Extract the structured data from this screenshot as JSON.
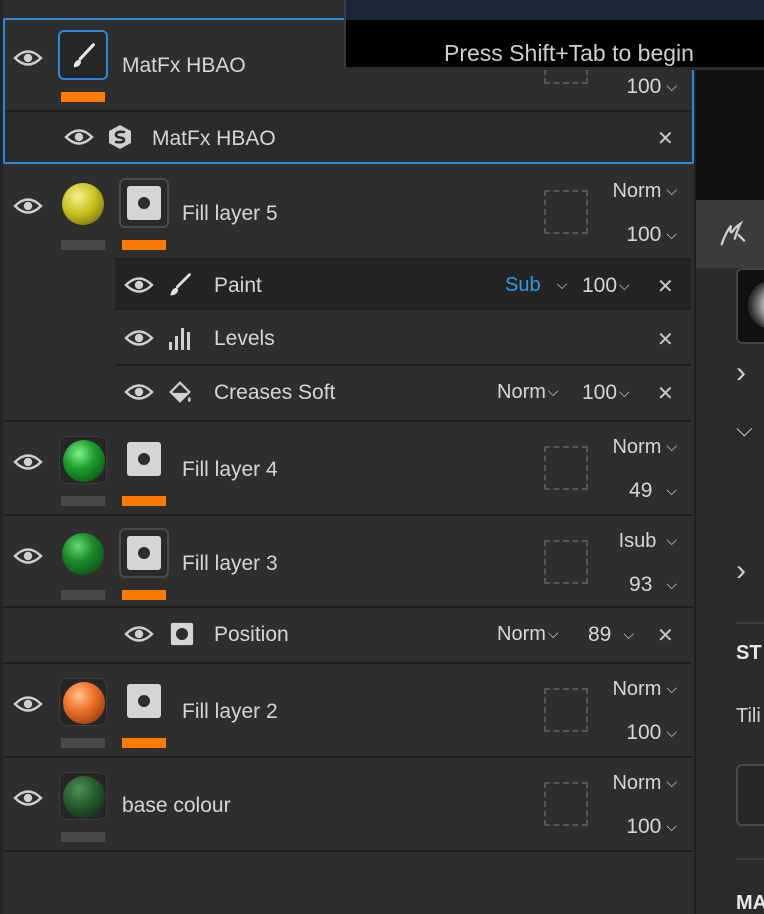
{
  "tooltip": {
    "message": "Press Shift+Tab to begin"
  },
  "layers": [
    {
      "name": "MatFx HBAO",
      "type": "paint",
      "opacity": "100",
      "selected": true,
      "effects": [
        {
          "name": "MatFx HBAO",
          "icon": "substance-icon"
        }
      ]
    },
    {
      "name": "Fill layer 5",
      "ball_color": "#c9c21f",
      "blend": "Norm",
      "opacity": "100",
      "effects": [
        {
          "name": "Paint",
          "icon": "brush-icon",
          "blend": "Sub",
          "opacity": "100"
        },
        {
          "name": "Levels",
          "icon": "levels-icon"
        },
        {
          "name": "Creases Soft",
          "icon": "fill-bucket-icon",
          "blend": "Norm",
          "opacity": "100"
        }
      ]
    },
    {
      "name": "Fill layer 4",
      "ball_color": "#1e9e2e",
      "blend": "Norm",
      "opacity": "49"
    },
    {
      "name": "Fill layer 3",
      "ball_color": "#1d8a2a",
      "blend": "Isub",
      "opacity": "93",
      "effects": [
        {
          "name": "Position",
          "icon": "mask-icon",
          "blend": "Norm",
          "opacity": "89"
        }
      ]
    },
    {
      "name": "Fill layer 2",
      "ball_color": "#f0712a",
      "blend": "Norm",
      "opacity": "100"
    },
    {
      "name": "base colour",
      "ball_color": "#245a2c",
      "blend": "Norm",
      "opacity": "100"
    }
  ],
  "right_panel": {
    "section_heading": "ST",
    "tiling_label": "Tili",
    "bottom_heading": "MA"
  },
  "glyphs": {
    "chev": "⌵",
    "close": "✕",
    "chev_right": "›"
  },
  "colors": {
    "accent": "#2e86d9",
    "orange": "#ff7a00",
    "blue_text": "#2b9be8"
  }
}
